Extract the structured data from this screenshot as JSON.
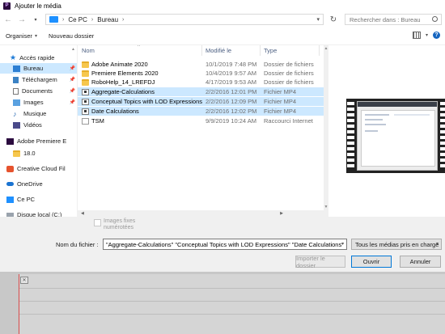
{
  "window": {
    "title": "Ajouter le média"
  },
  "address": {
    "crumbs": [
      "Ce PC",
      "Bureau"
    ],
    "search_placeholder": "Rechercher dans : Bureau"
  },
  "toolbar": {
    "organize": "Organiser",
    "new_folder": "Nouveau dossier"
  },
  "sidebar": {
    "items": [
      {
        "label": "Accès rapide",
        "icon": "star-icon"
      },
      {
        "label": "Bureau",
        "icon": "desktop-icon",
        "selected": true
      },
      {
        "label": "Téléchargem",
        "icon": "download-icon"
      },
      {
        "label": "Documents",
        "icon": "documents-icon"
      },
      {
        "label": "Images",
        "icon": "images-icon"
      },
      {
        "label": "Musique",
        "icon": "music-icon"
      },
      {
        "label": "Vidéos",
        "icon": "videos-icon"
      },
      {
        "label": "Adobe Premiere E",
        "icon": "premiere-icon"
      },
      {
        "label": "18.0",
        "icon": "folder-icon"
      },
      {
        "label": "Creative Cloud Fil",
        "icon": "creative-cloud-icon"
      },
      {
        "label": "OneDrive",
        "icon": "onedrive-icon"
      },
      {
        "label": "Ce PC",
        "icon": "pc-icon"
      },
      {
        "label": "Disque local (C:)",
        "icon": "drive-icon"
      }
    ]
  },
  "columns": {
    "name": "Nom",
    "modified": "Modifié le",
    "type": "Type"
  },
  "files": [
    {
      "name": "Adobe Animate 2020",
      "modified": "10/1/2019 7:48 PM",
      "type": "Dossier de fichiers",
      "kind": "folder"
    },
    {
      "name": "Premiere Elements 2020",
      "modified": "10/4/2019 9:57 AM",
      "type": "Dossier de fichiers",
      "kind": "folder"
    },
    {
      "name": "RoboHelp_14_LREFDJ",
      "modified": "4/17/2019 9:53 AM",
      "type": "Dossier de fichiers",
      "kind": "folder"
    },
    {
      "name": "Aggregate-Calculations",
      "modified": "2/2/2016 12:01 PM",
      "type": "Fichier MP4",
      "kind": "mp4",
      "selected": true
    },
    {
      "name": "Conceptual Topics with LOD Expressions",
      "modified": "2/2/2016 12:09 PM",
      "type": "Fichier MP4",
      "kind": "mp4",
      "selected": true
    },
    {
      "name": "Date Calculations",
      "modified": "2/2/2016 12:02 PM",
      "type": "Fichier MP4",
      "kind": "mp4",
      "selected": true
    },
    {
      "name": "TSM",
      "modified": "9/9/2019 10:24 AM",
      "type": "Raccourci Internet",
      "kind": "url"
    }
  ],
  "bottom": {
    "checkbox_label": "Images fixes numérotées",
    "filename_label": "Nom du fichier :",
    "filename_value": "\"Aggregate-Calculations\" \"Conceptual Topics with LOD Expressions\" \"Date Calculations\"",
    "filetype_value": "Tous les médias pris en charge",
    "import_folder": "Importer le dossier",
    "open": "Ouvrir",
    "cancel": "Annuler"
  },
  "colors": {
    "selection": "#cce8ff",
    "accent": "#0078d7",
    "folder": "#f6c74e"
  }
}
